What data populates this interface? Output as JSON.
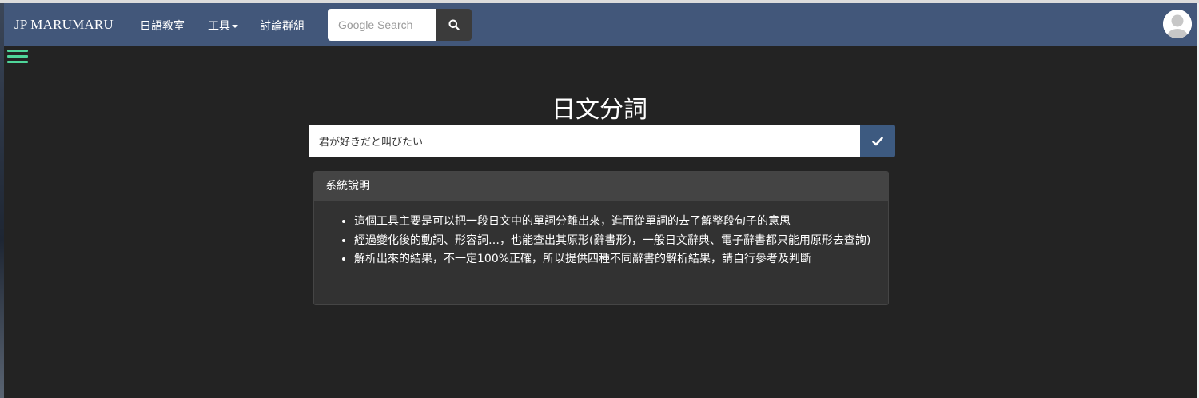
{
  "navbar": {
    "brand": "JP MARUMARU",
    "items": [
      {
        "label": "日語教室"
      },
      {
        "label": "工具"
      },
      {
        "label": "討論群組"
      }
    ],
    "search": {
      "placeholder": "Google Search",
      "button_icon": "search-icon"
    },
    "avatar_icon": "user-avatar-icon"
  },
  "sidebar_toggle_icon": "hamburger-menu-icon",
  "main": {
    "title": "日文分詞",
    "input_value": "君が好きだと叫びたい",
    "submit_icon": "check-icon"
  },
  "panel": {
    "heading": "系統說明",
    "items": [
      "這個工具主要是可以把一段日文中的單詞分離出來，進而從單詞的去了解整段句子的意思",
      "經過變化後的動詞、形容詞…，也能查出其原形(辭書形)，一般日文辭典、電子辭書都只能用原形去查詢)",
      "解析出來的結果，不一定100%正確，所以提供四種不同辭書的解析結果，請自行參考及判斷"
    ]
  },
  "colors": {
    "navbar": "#42577a",
    "background": "#232323",
    "submit_button": "#3d5a80",
    "hamburger": "#4fd69a",
    "panel_heading": "#444444",
    "panel_body": "#323232"
  }
}
